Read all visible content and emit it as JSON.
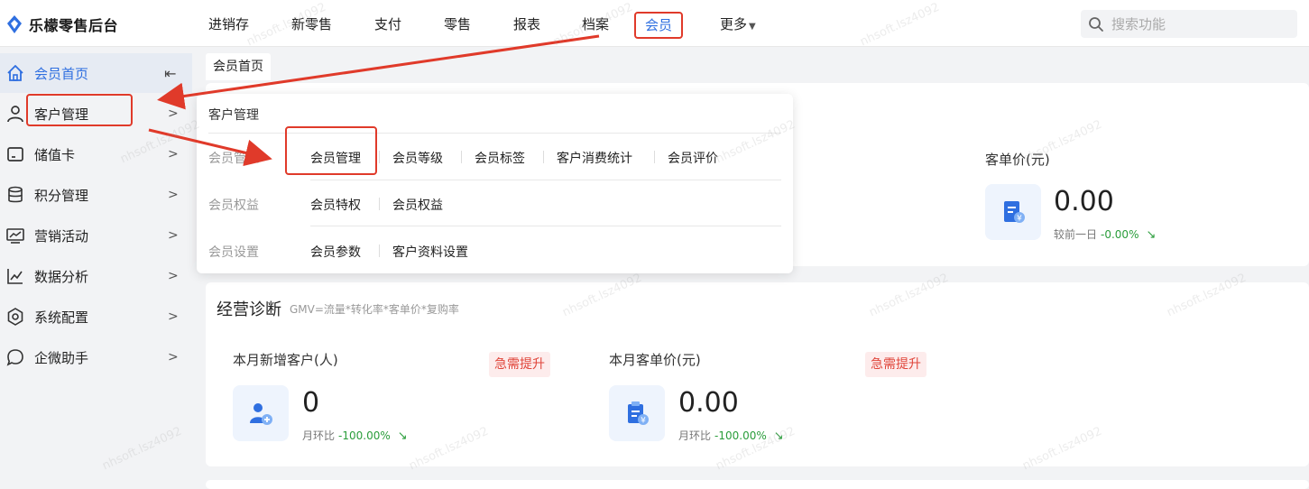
{
  "app": {
    "title": "乐檬零售后台"
  },
  "nav": {
    "items": [
      {
        "label": "进销存"
      },
      {
        "label": "新零售"
      },
      {
        "label": "支付"
      },
      {
        "label": "零售"
      },
      {
        "label": "报表"
      },
      {
        "label": "档案"
      },
      {
        "label": "会员"
      },
      {
        "label": "更多"
      }
    ],
    "active_index": 6,
    "search_placeholder": "搜索功能"
  },
  "sidebar": {
    "items": [
      {
        "label": "会员首页",
        "icon": "home-icon"
      },
      {
        "label": "客户管理",
        "icon": "user-icon"
      },
      {
        "label": "储值卡",
        "icon": "card-icon"
      },
      {
        "label": "积分管理",
        "icon": "database-icon"
      },
      {
        "label": "营销活动",
        "icon": "monitor-chart-icon"
      },
      {
        "label": "数据分析",
        "icon": "line-chart-icon"
      },
      {
        "label": "系统配置",
        "icon": "settings-icon"
      },
      {
        "label": "企微助手",
        "icon": "chat-icon"
      }
    ],
    "active_index": 0
  },
  "tab": {
    "label": "会员首页"
  },
  "summary": {
    "label": "客单价(元)",
    "value": "0.00",
    "compare_label": "较前一日",
    "compare_pct": "-0.00%"
  },
  "diagnosis": {
    "title": "经营诊断",
    "subtitle": "GMV=流量*转化率*客单价*复购率",
    "metrics": [
      {
        "label": "本月新增客户(人)",
        "value": "0",
        "compare_label": "月环比",
        "compare_pct": "-100.00%",
        "badge": "急需提升"
      },
      {
        "label": "本月客单价(元)",
        "value": "0.00",
        "compare_label": "月环比",
        "compare_pct": "-100.00%",
        "badge": "急需提升"
      }
    ]
  },
  "dropdown": {
    "title": "客户管理",
    "rows": [
      {
        "label": "会员管理",
        "links": [
          "会员管理",
          "会员等级",
          "会员标签",
          "客户消费统计",
          "会员评价"
        ]
      },
      {
        "label": "会员权益",
        "links": [
          "会员特权",
          "会员权益"
        ]
      },
      {
        "label": "会员设置",
        "links": [
          "会员参数",
          "客户资料设置"
        ]
      }
    ]
  },
  "watermark": "nhsoft.lsz4092",
  "colors": {
    "accent": "#2f6fe0",
    "highlight": "#e03a2a",
    "positive": "#2a9d3b",
    "badge_bg": "#fdecec"
  }
}
